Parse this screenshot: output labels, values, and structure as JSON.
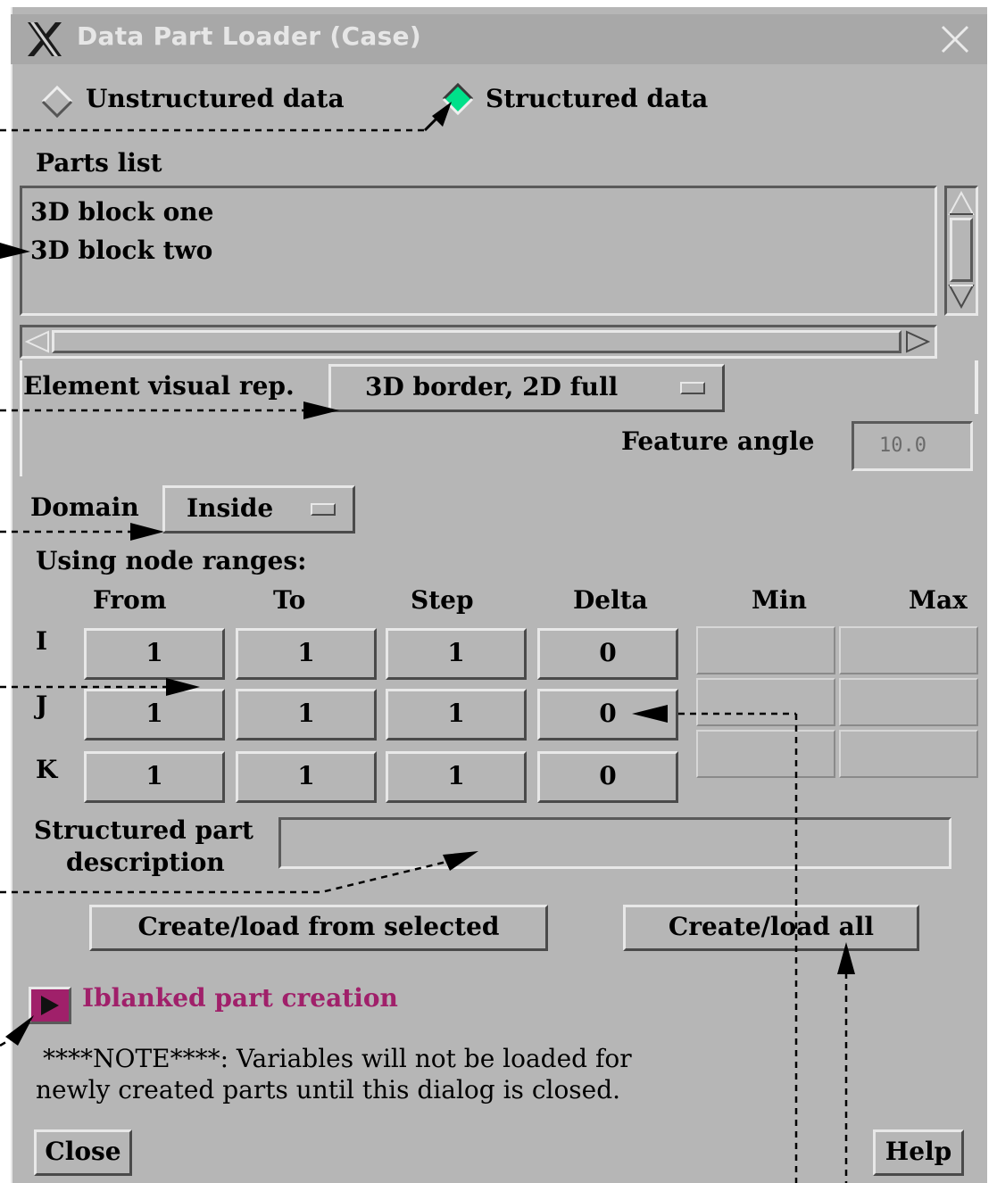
{
  "window": {
    "title": "Data Part Loader (Case)"
  },
  "data_type": {
    "options": [
      {
        "label": "Unstructured data",
        "selected": false
      },
      {
        "label": "Structured data",
        "selected": true
      }
    ],
    "selected_color": "#00e08a"
  },
  "parts_list": {
    "label": "Parts list",
    "items": [
      "3D block one",
      "3D block two"
    ]
  },
  "element_visual_rep": {
    "label": "Element visual rep.",
    "value": "3D border, 2D full"
  },
  "feature_angle": {
    "label": "Feature angle",
    "value": "10.0"
  },
  "domain": {
    "label": "Domain",
    "value": "Inside"
  },
  "node_ranges": {
    "label": "Using node ranges:",
    "headers": [
      "From",
      "To",
      "Step",
      "Delta",
      "Min",
      "Max"
    ],
    "rows": [
      {
        "name": "I",
        "from": "1",
        "to": "1",
        "step": "1",
        "delta": "0"
      },
      {
        "name": "J",
        "from": "1",
        "to": "1",
        "step": "1",
        "delta": "0"
      },
      {
        "name": "K",
        "from": "1",
        "to": "1",
        "step": "1",
        "delta": "0"
      }
    ]
  },
  "structured_description": {
    "label_line1": "Structured part",
    "label_line2": "description",
    "value": ""
  },
  "buttons": {
    "create_selected": "Create/load from selected",
    "create_all": "Create/load all",
    "close": "Close",
    "help": "Help"
  },
  "iblanked": {
    "label": "Iblanked part creation",
    "color": "#a0206a"
  },
  "note": {
    "line1": "****NOTE****: Variables will not be loaded for",
    "line2": "newly created parts until this dialog is closed."
  }
}
